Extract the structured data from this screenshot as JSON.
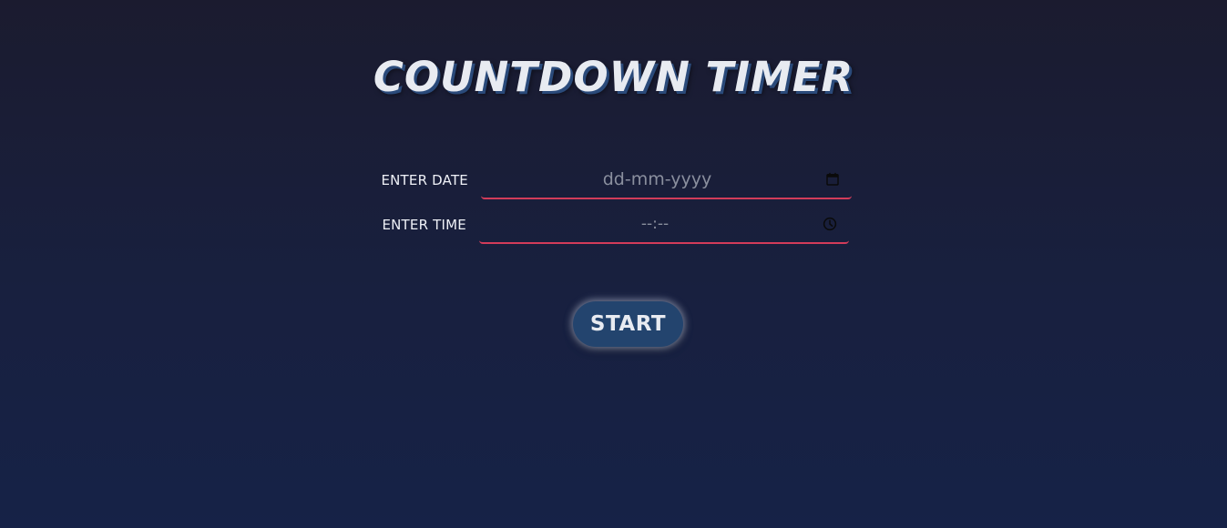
{
  "app": {
    "title": "COUNTDOWN TIMER"
  },
  "form": {
    "date": {
      "label": "ENTER DATE",
      "placeholder": "dd-mm-yyyy",
      "icon": "calendar-icon"
    },
    "time": {
      "label": "ENTER TIME",
      "placeholder": "--:--",
      "icon": "clock-icon"
    }
  },
  "actions": {
    "start_label": "START"
  },
  "colors": {
    "accent_underline": "#d23c5a",
    "button_bg": "#23446e",
    "background_top": "#1b1b2f",
    "background_bottom": "#162247"
  }
}
